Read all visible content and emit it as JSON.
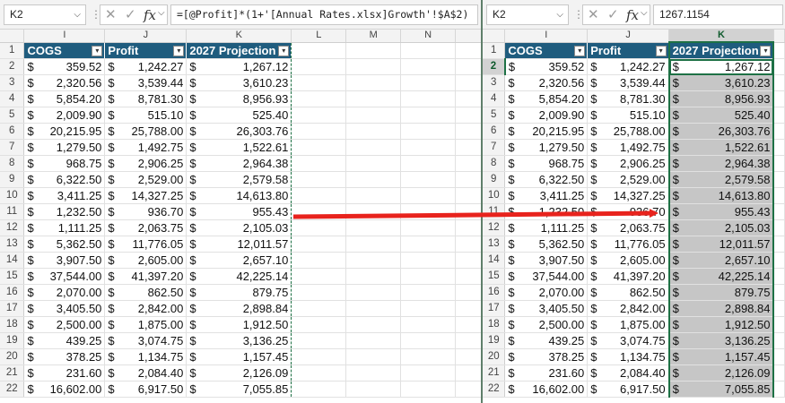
{
  "left": {
    "name_box": "K2",
    "formula": "=[@Profit]*(1+'[Annual Rates.xlsx]Growth'!$A$2)",
    "columns": [
      "I",
      "J",
      "K",
      "L",
      "M",
      "N"
    ]
  },
  "right": {
    "name_box": "K2",
    "formula": "1267.1154",
    "columns": [
      "I",
      "J",
      "K"
    ]
  },
  "toolbar": {
    "cancel_glyph": "✕",
    "enter_glyph": "✓",
    "fx_glyph": "fx",
    "chevron_glyph": "⌵",
    "dots_glyph": "⋮"
  },
  "table": {
    "headers": [
      "COGS",
      "Profit",
      "2027 Projection"
    ],
    "dropdown_glyph": "▾",
    "currency": "$",
    "first_row_number": "1",
    "rows": [
      {
        "n": "2",
        "cogs": "359.52",
        "profit": "1,242.27",
        "proj": "1,267.12"
      },
      {
        "n": "3",
        "cogs": "2,320.56",
        "profit": "3,539.44",
        "proj": "3,610.23"
      },
      {
        "n": "4",
        "cogs": "5,854.20",
        "profit": "8,781.30",
        "proj": "8,956.93"
      },
      {
        "n": "5",
        "cogs": "2,009.90",
        "profit": "515.10",
        "proj": "525.40"
      },
      {
        "n": "6",
        "cogs": "20,215.95",
        "profit": "25,788.00",
        "proj": "26,303.76"
      },
      {
        "n": "7",
        "cogs": "1,279.50",
        "profit": "1,492.75",
        "proj": "1,522.61"
      },
      {
        "n": "8",
        "cogs": "968.75",
        "profit": "2,906.25",
        "proj": "2,964.38"
      },
      {
        "n": "9",
        "cogs": "6,322.50",
        "profit": "2,529.00",
        "proj": "2,579.58"
      },
      {
        "n": "10",
        "cogs": "3,411.25",
        "profit": "14,327.25",
        "proj": "14,613.80"
      },
      {
        "n": "11",
        "cogs": "1,232.50",
        "profit": "936.70",
        "proj": "955.43"
      },
      {
        "n": "12",
        "cogs": "1,111.25",
        "profit": "2,063.75",
        "proj": "2,105.03"
      },
      {
        "n": "13",
        "cogs": "5,362.50",
        "profit": "11,776.05",
        "proj": "12,011.57"
      },
      {
        "n": "14",
        "cogs": "3,907.50",
        "profit": "2,605.00",
        "proj": "2,657.10"
      },
      {
        "n": "15",
        "cogs": "37,544.00",
        "profit": "41,397.20",
        "proj": "42,225.14"
      },
      {
        "n": "16",
        "cogs": "2,070.00",
        "profit": "862.50",
        "proj": "879.75"
      },
      {
        "n": "17",
        "cogs": "3,405.50",
        "profit": "2,842.00",
        "proj": "2,898.84"
      },
      {
        "n": "18",
        "cogs": "2,500.00",
        "profit": "1,875.00",
        "proj": "1,912.50"
      },
      {
        "n": "19",
        "cogs": "439.25",
        "profit": "3,074.75",
        "proj": "3,136.25"
      },
      {
        "n": "20",
        "cogs": "378.25",
        "profit": "1,134.75",
        "proj": "1,157.45"
      },
      {
        "n": "21",
        "cogs": "231.60",
        "profit": "2,084.40",
        "proj": "2,126.09"
      },
      {
        "n": "22",
        "cogs": "16,602.00",
        "profit": "6,917.50",
        "proj": "7,055.85"
      }
    ]
  },
  "colors": {
    "table_header": "#1f5c7e",
    "selection": "#1e7145",
    "arrow": "#e8231d"
  }
}
